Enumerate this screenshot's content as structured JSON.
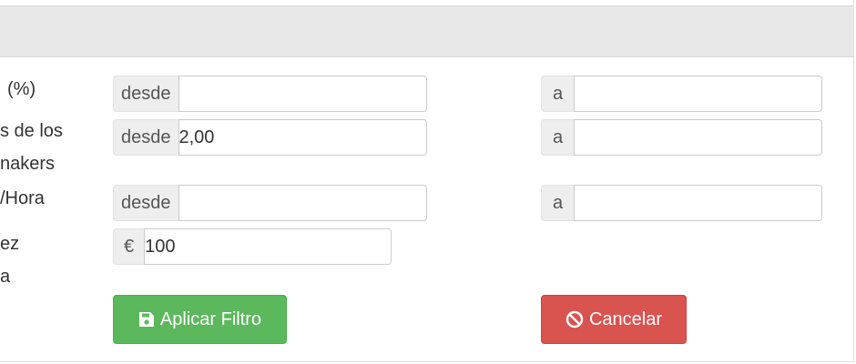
{
  "filters": {
    "row1": {
      "label_lines": [
        "(%)"
      ],
      "from_addon": "desde",
      "from_value": "",
      "to_addon": "a",
      "to_value": ""
    },
    "row2": {
      "label_lines": [
        "s de los",
        "nakers"
      ],
      "from_addon": "desde",
      "from_value": "2,00",
      "to_addon": "a",
      "to_value": ""
    },
    "row3": {
      "label_lines": [
        "/Hora"
      ],
      "from_addon": "desde",
      "from_value": "",
      "to_addon": "a",
      "to_value": ""
    },
    "row4": {
      "label_lines": [
        "ez",
        "a"
      ],
      "currency_addon": "€",
      "amount_value": "100"
    }
  },
  "buttons": {
    "apply_label": "Aplicar Filtro",
    "apply_icon": "floppy-disk-icon",
    "cancel_label": "Cancelar",
    "cancel_icon": "ban-icon"
  },
  "colors": {
    "apply": "#5cb85c",
    "cancel": "#d9534f",
    "header": "#e8e8e8"
  }
}
